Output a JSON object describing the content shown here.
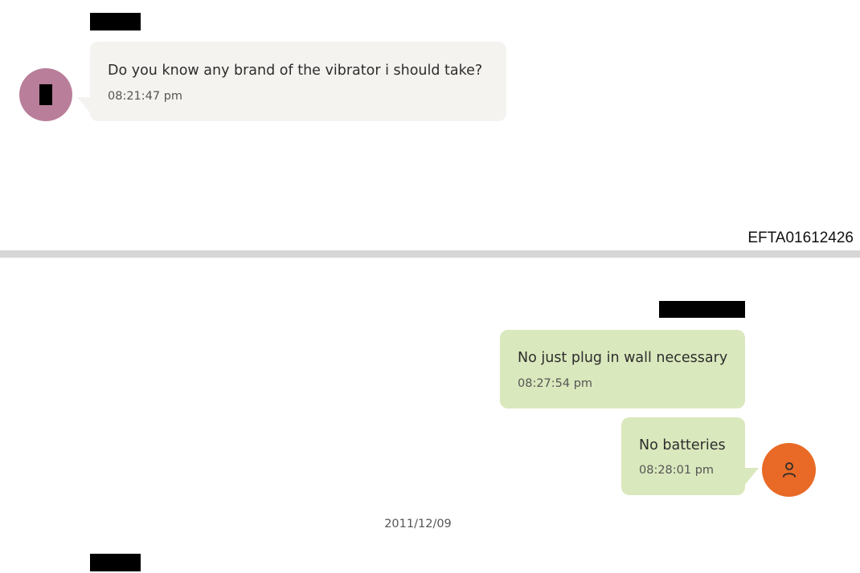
{
  "messages": [
    {
      "direction": "incoming",
      "text": "Do you know any brand of the vibrator i should take?",
      "time": "08:21:47 pm"
    },
    {
      "direction": "outgoing",
      "text": "No just plug in wall necessary",
      "time": "08:27:54 pm"
    },
    {
      "direction": "outgoing",
      "text": "No batteries",
      "time": "08:28:01 pm"
    }
  ],
  "page_footer": {
    "document_id": "EFTA01612426"
  },
  "date_separator": "2011/12/09",
  "icons": {
    "incoming_avatar": "redacted-avatar",
    "outgoing_avatar": "person-icon"
  },
  "colors": {
    "incoming_bubble": "#f4f3f0",
    "outgoing_bubble": "#dae8bd",
    "incoming_avatar": "#b97e9a",
    "outgoing_avatar": "#e86a26",
    "divider": "#d6d6d6"
  }
}
